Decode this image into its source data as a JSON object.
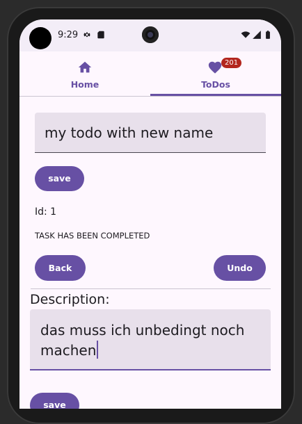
{
  "status_bar": {
    "time": "9:29",
    "icons": [
      "settings-icon",
      "sd-card-icon",
      "wifi-icon",
      "signal-icon",
      "battery-icon"
    ]
  },
  "nav": {
    "tabs": [
      {
        "label": "Home",
        "icon": "home-icon",
        "selected": false
      },
      {
        "label": "ToDos",
        "icon": "heart-icon",
        "selected": true,
        "badge": "201"
      }
    ]
  },
  "todo": {
    "name_value": "my todo with new name",
    "save_label": "save",
    "id_text": "Id: 1",
    "status_text": "TASK HAS BEEN COMPLETED",
    "back_label": "Back",
    "undo_label": "Undo"
  },
  "description": {
    "label": "Description:",
    "value_line1": "das muss ich unbedingt noch",
    "value_line2": "machen",
    "save_label": "save"
  },
  "colors": {
    "primary": "#6750a4",
    "surface_variant": "#e8e0eb",
    "badge": "#b3261e"
  }
}
